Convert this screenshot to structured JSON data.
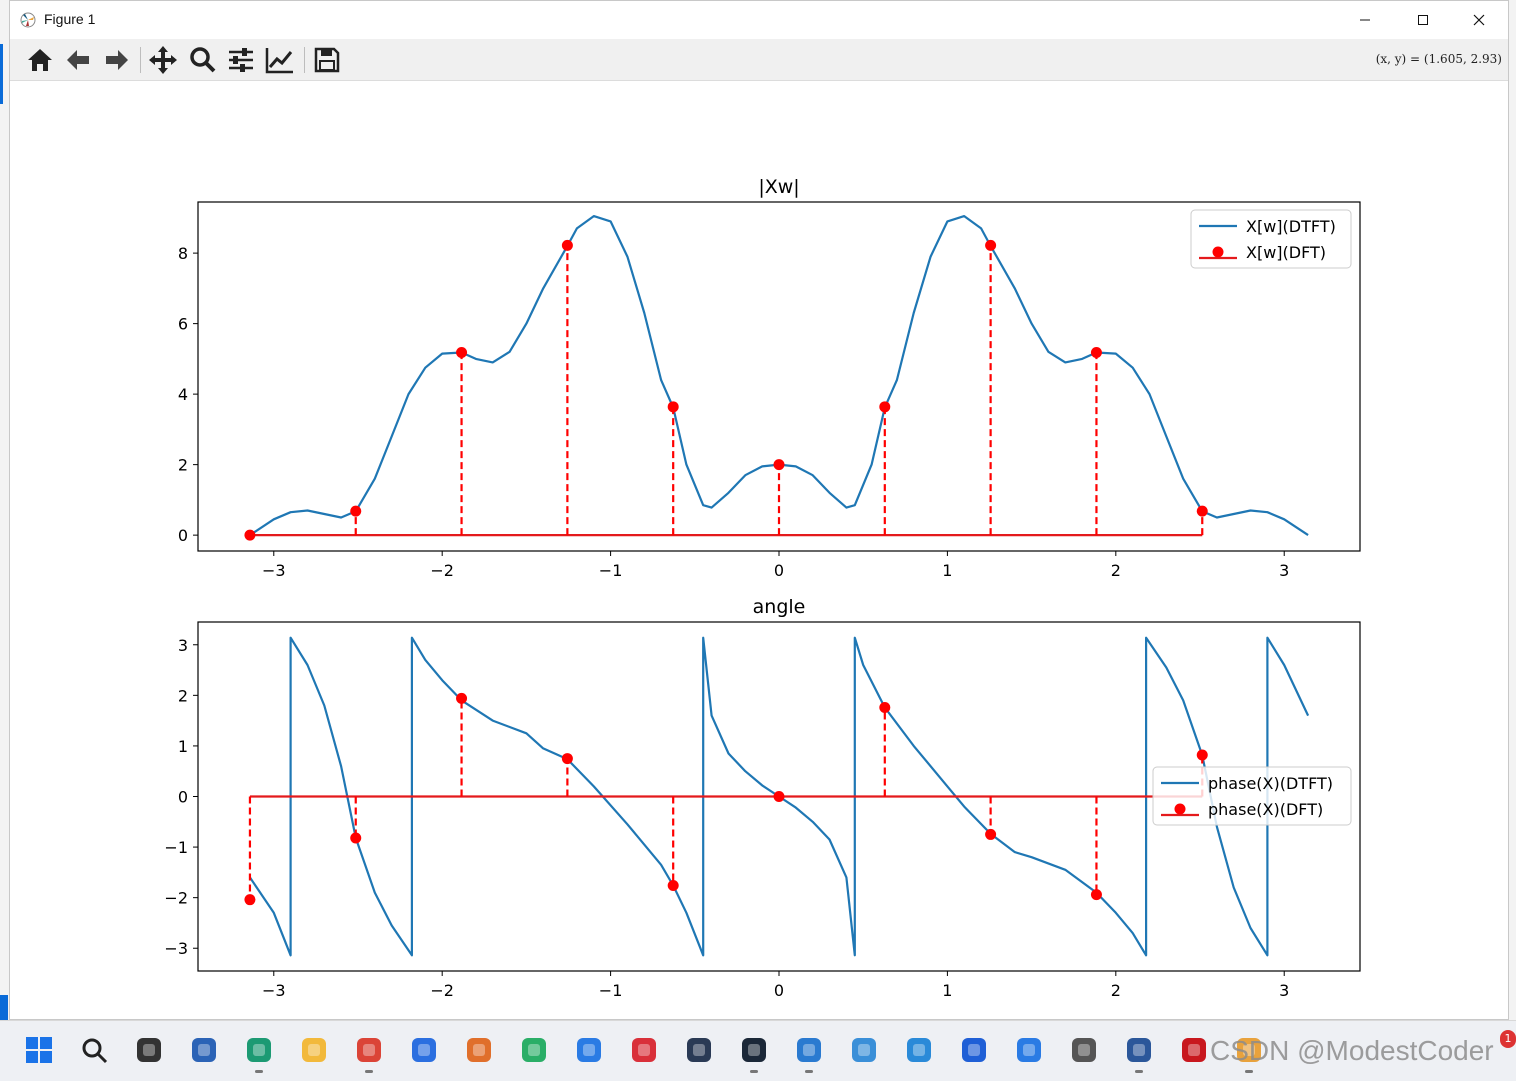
{
  "window": {
    "title": "Figure 1"
  },
  "toolbar": {
    "buttons": [
      "home-icon",
      "back-arrow-icon",
      "forward-arrow-icon",
      "pan-move-icon",
      "zoom-magnifier-icon",
      "configure-subplots-icon",
      "edit-axis-icon",
      "save-floppy-icon"
    ],
    "coords": "(x, y) = (1.605, 2.93)"
  },
  "chart_data": [
    {
      "type": "line",
      "title": "|Xw|",
      "xlim": [
        -3.45,
        3.45
      ],
      "ylim": [
        -0.45,
        9.45
      ],
      "xticks": [
        -3,
        -2,
        -1,
        0,
        1,
        2,
        3
      ],
      "xtick_labels": [
        "−3",
        "−2",
        "−1",
        "0",
        "1",
        "2",
        "3"
      ],
      "yticks": [
        0,
        2,
        4,
        6,
        8
      ],
      "ytick_labels": [
        "0",
        "2",
        "4",
        "6",
        "8"
      ],
      "legend_position": "upper-right",
      "series": [
        {
          "name": "X[w](DTFT)",
          "kind": "line",
          "color": "#1f77b4",
          "x": [
            -3.1416,
            -3.0,
            -2.9,
            -2.8,
            -2.7,
            -2.6,
            -2.513,
            -2.4,
            -2.3,
            -2.2,
            -2.1,
            -2.0,
            -1.885,
            -1.8,
            -1.7,
            -1.6,
            -1.5,
            -1.4,
            -1.257,
            -1.2,
            -1.1,
            -1.0,
            -0.9,
            -0.8,
            -0.7,
            -0.628,
            -0.55,
            -0.45,
            -0.4,
            -0.3,
            -0.2,
            -0.1,
            0.0,
            0.1,
            0.2,
            0.3,
            0.4,
            0.45,
            0.55,
            0.628,
            0.7,
            0.8,
            0.9,
            1.0,
            1.1,
            1.2,
            1.257,
            1.4,
            1.5,
            1.6,
            1.7,
            1.8,
            1.885,
            2.0,
            2.1,
            2.2,
            2.3,
            2.4,
            2.513,
            2.6,
            2.7,
            2.8,
            2.9,
            3.0,
            3.1416
          ],
          "y": [
            0.0,
            0.45,
            0.65,
            0.7,
            0.6,
            0.5,
            0.68,
            1.6,
            2.8,
            4.0,
            4.75,
            5.15,
            5.18,
            5.0,
            4.9,
            5.2,
            6.0,
            7.0,
            8.2,
            8.7,
            9.05,
            8.9,
            7.9,
            6.3,
            4.4,
            3.62,
            2.0,
            0.85,
            0.78,
            1.2,
            1.7,
            1.95,
            2.0,
            1.95,
            1.7,
            1.2,
            0.78,
            0.85,
            2.0,
            3.62,
            4.4,
            6.3,
            7.9,
            8.9,
            9.05,
            8.7,
            8.2,
            7.0,
            6.0,
            5.2,
            4.9,
            5.0,
            5.18,
            5.15,
            4.75,
            4.0,
            2.8,
            1.6,
            0.68,
            0.5,
            0.6,
            0.7,
            0.65,
            0.45,
            0.0
          ]
        },
        {
          "name": "X[w](DFT)",
          "kind": "stem",
          "color": "#ff0000",
          "x": [
            -3.1416,
            -2.5133,
            -1.885,
            -1.2566,
            -0.6283,
            0.0,
            0.6283,
            1.2566,
            1.885,
            2.5133
          ],
          "y": [
            0.0,
            0.68,
            5.18,
            8.22,
            3.64,
            2.0,
            3.64,
            8.22,
            5.18,
            0.68
          ]
        }
      ]
    },
    {
      "type": "line",
      "title": "angle",
      "xlim": [
        -3.45,
        3.45
      ],
      "ylim": [
        -3.45,
        3.45
      ],
      "xticks": [
        -3,
        -2,
        -1,
        0,
        1,
        2,
        3
      ],
      "xtick_labels": [
        "−3",
        "−2",
        "−1",
        "0",
        "1",
        "2",
        "3"
      ],
      "yticks": [
        -3,
        -2,
        -1,
        0,
        1,
        2,
        3
      ],
      "ytick_labels": [
        "−3",
        "−2",
        "−1",
        "0",
        "1",
        "2",
        "3"
      ],
      "legend_position": "center-right",
      "series": [
        {
          "name": "phase(X)(DTFT)",
          "kind": "line",
          "color": "#1f77b4",
          "x": [
            -3.1416,
            -3.0,
            -2.9,
            -2.9,
            -2.8,
            -2.7,
            -2.6,
            -2.513,
            -2.4,
            -2.3,
            -2.18,
            -2.18,
            -2.1,
            -2.0,
            -1.885,
            -1.7,
            -1.5,
            -1.4,
            -1.257,
            -1.1,
            -0.9,
            -0.7,
            -0.628,
            -0.55,
            -0.45,
            -0.45,
            -0.4,
            -0.3,
            -0.2,
            -0.1,
            0.0,
            0.1,
            0.2,
            0.3,
            0.4,
            0.45,
            0.45,
            0.5,
            0.628,
            0.8,
            1.0,
            1.1,
            1.257,
            1.4,
            1.5,
            1.7,
            1.885,
            2.0,
            2.1,
            2.18,
            2.18,
            2.3,
            2.4,
            2.513,
            2.6,
            2.7,
            2.8,
            2.9,
            2.9,
            3.0,
            3.1416
          ],
          "y": [
            -1.6,
            -2.3,
            -3.14,
            3.14,
            2.6,
            1.8,
            0.6,
            -0.82,
            -1.9,
            -2.55,
            -3.14,
            3.14,
            2.7,
            2.3,
            1.9,
            1.5,
            1.25,
            0.95,
            0.74,
            0.2,
            -0.55,
            -1.35,
            -1.76,
            -2.3,
            -3.14,
            3.14,
            1.6,
            0.85,
            0.5,
            0.22,
            0.0,
            -0.22,
            -0.5,
            -0.85,
            -1.6,
            -3.14,
            3.14,
            2.6,
            1.76,
            1.0,
            0.2,
            -0.2,
            -0.74,
            -1.1,
            -1.2,
            -1.45,
            -1.9,
            -2.3,
            -2.7,
            -3.14,
            3.14,
            2.55,
            1.9,
            0.82,
            -0.6,
            -1.8,
            -2.6,
            -3.14,
            3.14,
            2.6,
            1.6
          ]
        },
        {
          "name": "phase(X)(DFT)",
          "kind": "stem",
          "color": "#ff0000",
          "x": [
            -3.1416,
            -2.5133,
            -1.885,
            -1.2566,
            -0.6283,
            0.0,
            0.6283,
            1.2566,
            1.885,
            2.5133
          ],
          "y": [
            -2.04,
            -0.82,
            1.94,
            0.75,
            -1.76,
            0.0,
            1.76,
            -0.75,
            -1.94,
            0.82
          ]
        }
      ]
    }
  ],
  "taskbar": {
    "apps": [
      "windows-start-icon",
      "search-icon",
      "task-view-icon",
      "store-icon",
      "edge-dev-icon",
      "file-explorer-icon",
      "chrome-icon",
      "baidu-netdisk-icon",
      "paint-icon",
      "wechat-icon",
      "tencent-meeting-icon",
      "netease-music-icon",
      "cat-app-icon",
      "steam-icon",
      "vscode-icon",
      "system-monitor-icon",
      "notepad-icon",
      "feishu-icon",
      "bird-app-icon",
      "calculator-icon",
      "word-icon",
      "acrobat-icon",
      "tray-icon"
    ],
    "watermark": "CSDN @ModestCoder",
    "badge": "1"
  }
}
